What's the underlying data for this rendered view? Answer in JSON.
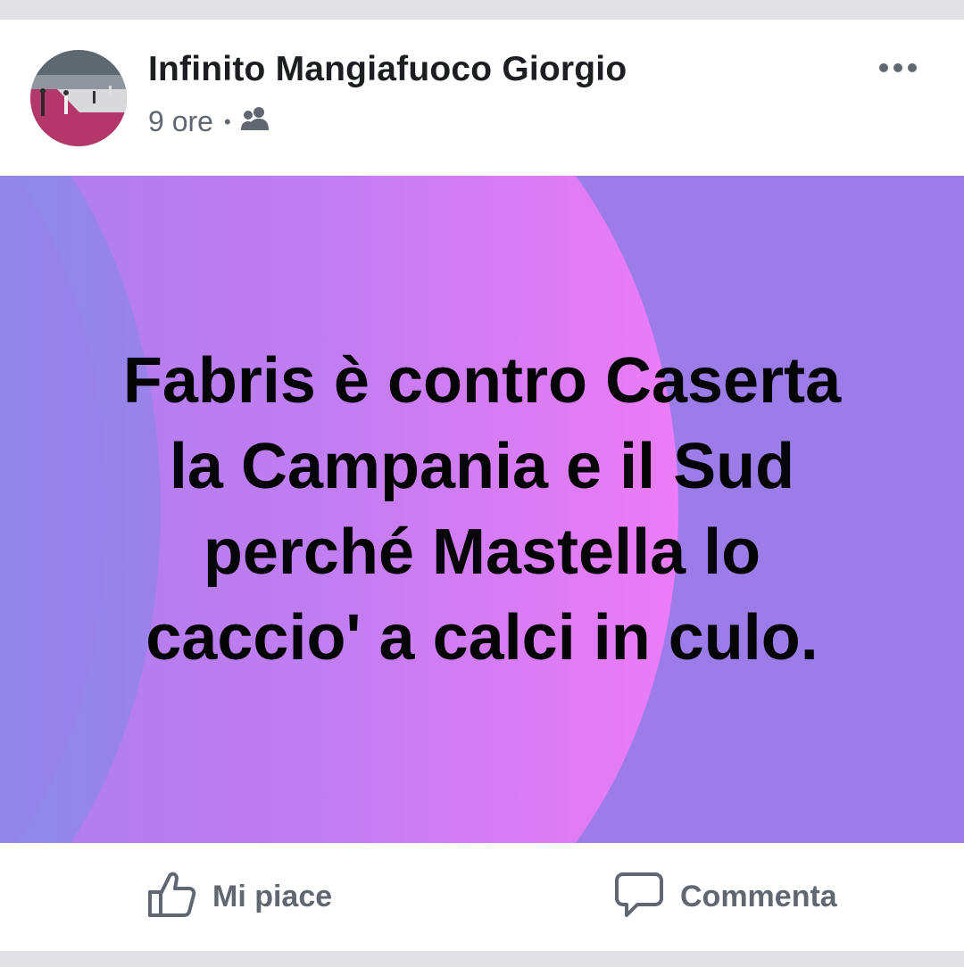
{
  "post": {
    "author": "Infinito Mangiafuoco Giorgio",
    "time": "9 ore",
    "separator": "•",
    "audience_icon": "friends-icon",
    "more_icon": "more-options-icon",
    "text": "Fabris è contro Caserta\nla Campania e il Sud\nperché Mastella lo\ncaccio' a calci in culo.",
    "background_colors": {
      "base": "#9c7ce8",
      "pink": "#e47cf6",
      "blue": "#6a9cf0"
    }
  },
  "actions": {
    "like_label": "Mi piace",
    "like_icon": "thumbs-up-icon",
    "comment_label": "Commenta",
    "comment_icon": "comment-bubble-icon"
  }
}
